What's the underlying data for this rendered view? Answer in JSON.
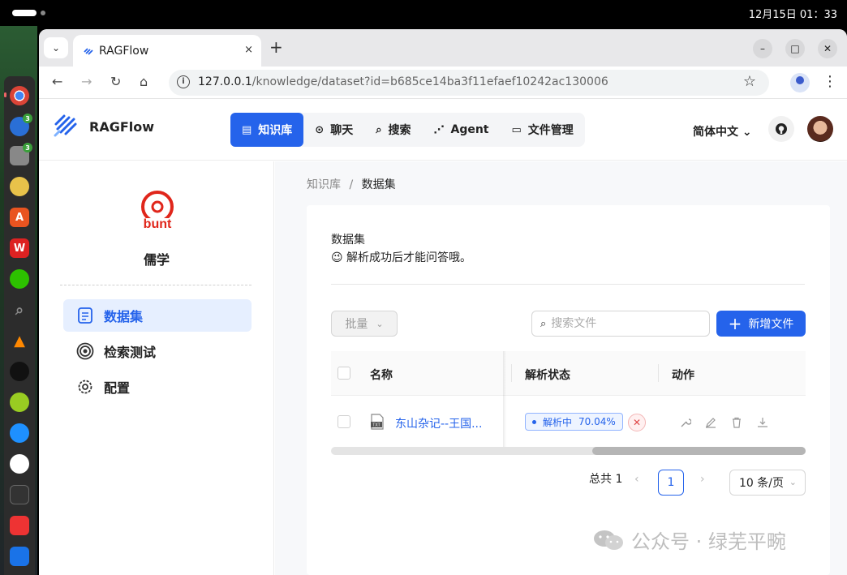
{
  "os": {
    "clock": "12月15日 01：33"
  },
  "browser": {
    "tab_title": "RAGFlow",
    "tab_close": "×",
    "newtab": "+",
    "url_host": "127.0.0.1",
    "url_path": "/knowledge/dataset?id=b685ce14ba3f11efaef10242ac130006"
  },
  "app": {
    "brand": "RAGFlow",
    "nav": [
      {
        "label": "知识库",
        "icon": "database-icon",
        "active": true
      },
      {
        "label": "聊天",
        "icon": "chat-icon"
      },
      {
        "label": "搜索",
        "icon": "search-icon"
      },
      {
        "label": "Agent",
        "icon": "agent-icon"
      },
      {
        "label": "文件管理",
        "icon": "folder-icon"
      }
    ],
    "language": "简体中文"
  },
  "sidebar": {
    "kb_name": "儒学",
    "kb_logo_text": "bunt",
    "items": [
      {
        "label": "数据集",
        "active": true
      },
      {
        "label": "检索测试"
      },
      {
        "label": "配置"
      }
    ]
  },
  "main": {
    "breadcrumb": {
      "root": "知识库",
      "sep": "/",
      "current": "数据集"
    },
    "title": "数据集",
    "subtitle": "😉 解析成功后才能问答哦。",
    "bulk_label": "批量",
    "search_placeholder": "搜索文件",
    "add_label": "新增文件",
    "table": {
      "headers": {
        "name": "名称",
        "status": "解析状态",
        "action": "动作"
      },
      "rows": [
        {
          "name": "东山杂记--王国...",
          "status": "解析中",
          "progress": "70.04%"
        }
      ]
    },
    "pagination": {
      "total": "总共 1",
      "current": "1",
      "size": "10 条/页"
    }
  },
  "watermark": "公众号 · 绿芜平畹",
  "colors": {
    "primary": "#2563eb",
    "danger": "#e04848"
  }
}
